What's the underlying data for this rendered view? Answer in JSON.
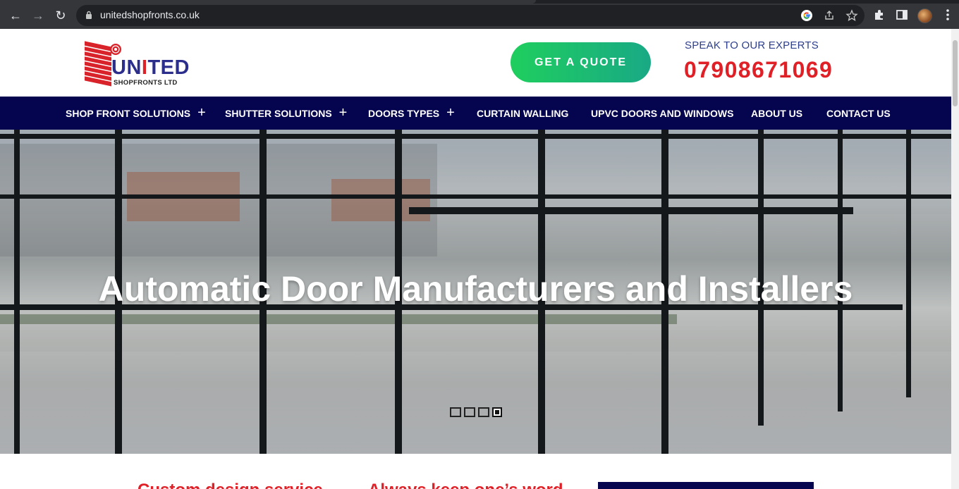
{
  "browser": {
    "url": "unitedshopfronts.co.uk",
    "nav": {
      "back": "←",
      "forward": "→",
      "reload": "↻"
    },
    "icons": [
      "lock-icon",
      "google-icon",
      "share-icon",
      "bookmark-star-icon",
      "extensions-icon",
      "side-panel-icon",
      "profile-avatar",
      "menu-kebab-icon"
    ]
  },
  "header": {
    "logo": {
      "word": "UNITED",
      "subtitle": "SHOPFRONTS LTD"
    },
    "quote_button": "GET A QUOTE",
    "experts_label": "SPEAK TO OUR EXPERTS",
    "phone": "07908671069"
  },
  "nav": {
    "items": [
      {
        "label": "SHOP FRONT SOLUTIONS",
        "has_submenu": true
      },
      {
        "label": "SHUTTER SOLUTIONS",
        "has_submenu": true
      },
      {
        "label": "DOORS TYPES",
        "has_submenu": true
      },
      {
        "label": "CURTAIN WALLING",
        "has_submenu": false
      },
      {
        "label": "UPVC DOORS AND WINDOWS",
        "has_submenu": false
      },
      {
        "label": "ABOUT US",
        "has_submenu": false
      },
      {
        "label": "CONTACT US",
        "has_submenu": false
      }
    ],
    "submenu_symbol": "+"
  },
  "hero": {
    "title": "Automatic Door Manufacturers and Installers",
    "slides": 4,
    "active_slide": 4
  },
  "features": [
    {
      "title": "Custom design service"
    },
    {
      "title": "Always keep one’s word"
    }
  ],
  "colors": {
    "brand_blue": "#2c2e8c",
    "brand_red": "#e02027",
    "nav_bg": "#05044f",
    "quote_green": "#1fce5e"
  }
}
